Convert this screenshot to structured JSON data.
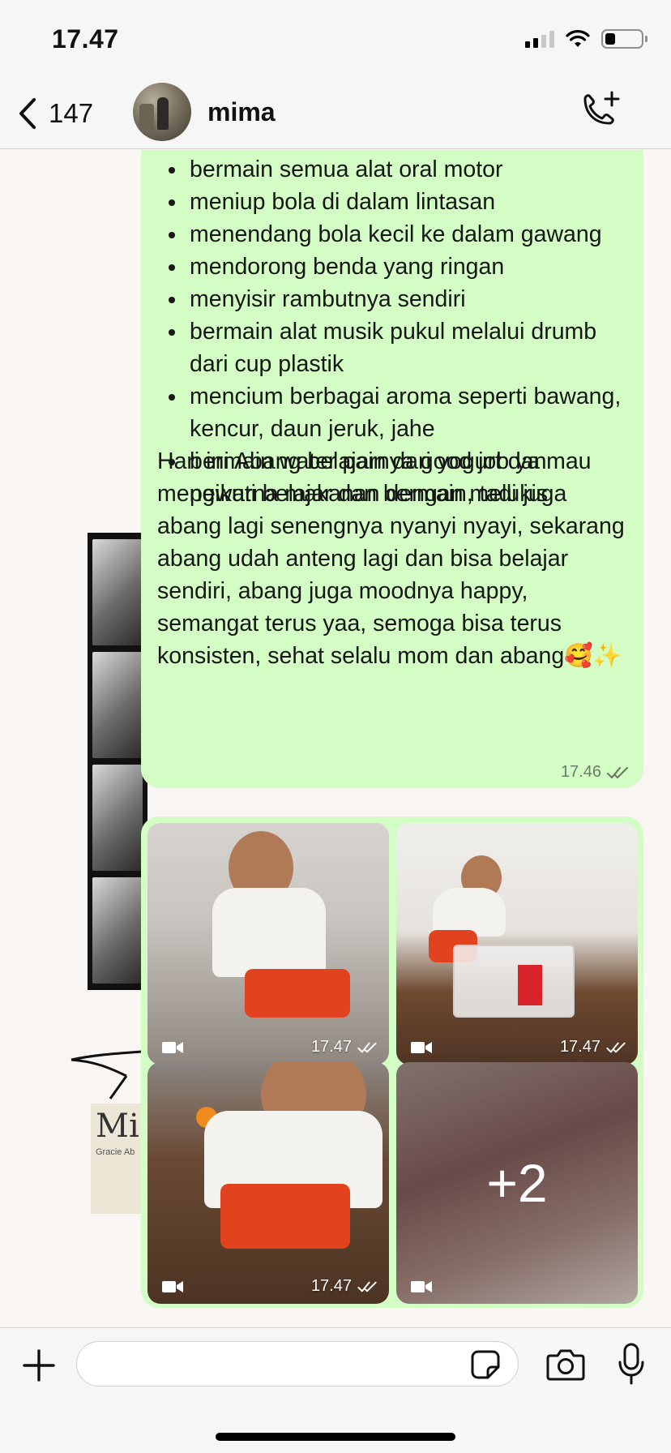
{
  "status_bar": {
    "time": "17.47",
    "battery_percent": 30
  },
  "header": {
    "back_count": "147",
    "contact_name": "mima"
  },
  "message": {
    "bullets": [
      "bermain semua alat oral motor",
      "meniup bola di dalam lintasan",
      "menendang bola kecil ke dalam gawang",
      "mendorong benda yang ringan",
      "menyisir rambutnya sendiri",
      "bermain alat musik pukul melalui drumb dari cup plastik",
      "mencium berbagai aroma seperti bawang, kencur, daun jeruk, jahe",
      "bermain water pain dari yogurt dan pewarna makanan dengan melukis"
    ],
    "paragraph": "Hari ini Abang belajarnya good job ya mau mengikuti belajar dan bermain, tadi juga abang lagi senengnya nyanyi nyayi, sekarang abang udah anteng lagi dan bisa belajar sendiri, abang juga moodnya happy, semangat terus yaa, semoga bisa terus konsisten, sehat selalu mom dan abang🥰✨",
    "time": "17.46",
    "status": "read"
  },
  "media": {
    "items": [
      {
        "type": "video",
        "time": "17.47"
      },
      {
        "type": "video",
        "time": "17.47"
      },
      {
        "type": "video",
        "time": "17.47"
      },
      {
        "type": "video",
        "more_count": "+2"
      }
    ]
  },
  "wallpaper": {
    "paper_big": "Mi",
    "paper_small": "Gracie Ab"
  },
  "input": {
    "placeholder": ""
  },
  "colors": {
    "bubble": "#d3fdc5",
    "background": "#f8f5f2",
    "header": "#f6f6f6",
    "read_ticks": "#6f7b6a"
  }
}
